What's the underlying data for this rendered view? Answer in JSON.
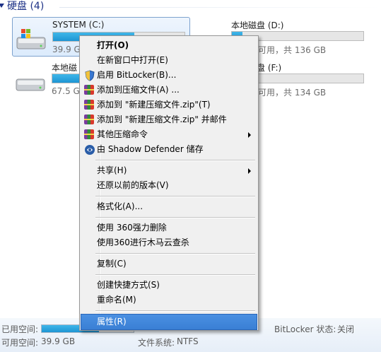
{
  "section": {
    "title": "硬盘 (4)"
  },
  "drives": [
    {
      "name": "SYSTEM (C:)",
      "space": "39.9 GB 可用，共 … GB",
      "usage": 0.62
    },
    {
      "name": "本地磁盘 (D:)",
      "space": "… GB 可用，共 136 GB",
      "usage": 0.08
    },
    {
      "name": "本地磁盘 (E:)",
      "space": "67.5 GB 可用，共 … GB",
      "usage": 0.4
    },
    {
      "name": "本地磁盘 (F:)",
      "space": "… GB 可用，共 134 GB",
      "usage": 0.08
    }
  ],
  "drive_text": {
    "c_name": "SYSTEM (C:)",
    "c_space": "39.9 GB",
    "d_name": "本地磁盘 (D:)",
    "d_space": "B 可用，共 136 GB",
    "e_name": "本地磁",
    "e_space": "67.5 G",
    "f_name": "盘 (F:)",
    "f_space": "B 可用，共 134 GB"
  },
  "details": {
    "used_label": "已用空间:",
    "free_label": "可用空间:",
    "free_value": "39.9 GB",
    "fs_label": "文件系统:",
    "fs_value": "NTFS",
    "bitlocker_label": "BitLocker 状态:",
    "bitlocker_value": "关闭",
    "usage": 0.62
  },
  "menu": {
    "items": [
      {
        "label": "打开(O)",
        "bold": true
      },
      {
        "label": "在新窗口中打开(E)"
      },
      {
        "label": "启用 BitLocker(B)...",
        "icon": "shield-icon"
      },
      {
        "label": "添加到压缩文件(A) ...",
        "icon": "winrar-icon"
      },
      {
        "label": "添加到 \"新建压缩文件.zip\"(T)",
        "icon": "winrar-icon"
      },
      {
        "label": "添加到 \"新建压缩文件.zip\" 并邮件",
        "icon": "winrar-icon"
      },
      {
        "label": "其他压缩命令",
        "icon": "winrar-icon",
        "submenu": true
      },
      {
        "label": "由 Shadow Defender 储存",
        "icon": "shadow-defender-icon"
      },
      {
        "label": "共享(H)",
        "submenu": true
      },
      {
        "label": "还原以前的版本(V)"
      },
      {
        "label": "格式化(A)..."
      },
      {
        "label": "使用 360强力删除"
      },
      {
        "label": "使用360进行木马云查杀"
      },
      {
        "label": "复制(C)"
      },
      {
        "label": "创建快捷方式(S)"
      },
      {
        "label": "重命名(M)"
      },
      {
        "label": "属性(R)",
        "highlighted": true
      }
    ]
  },
  "colors": {
    "header": "#1e3287",
    "highlight": "#3a7fd4",
    "bar_fill": "#1e95d3"
  }
}
